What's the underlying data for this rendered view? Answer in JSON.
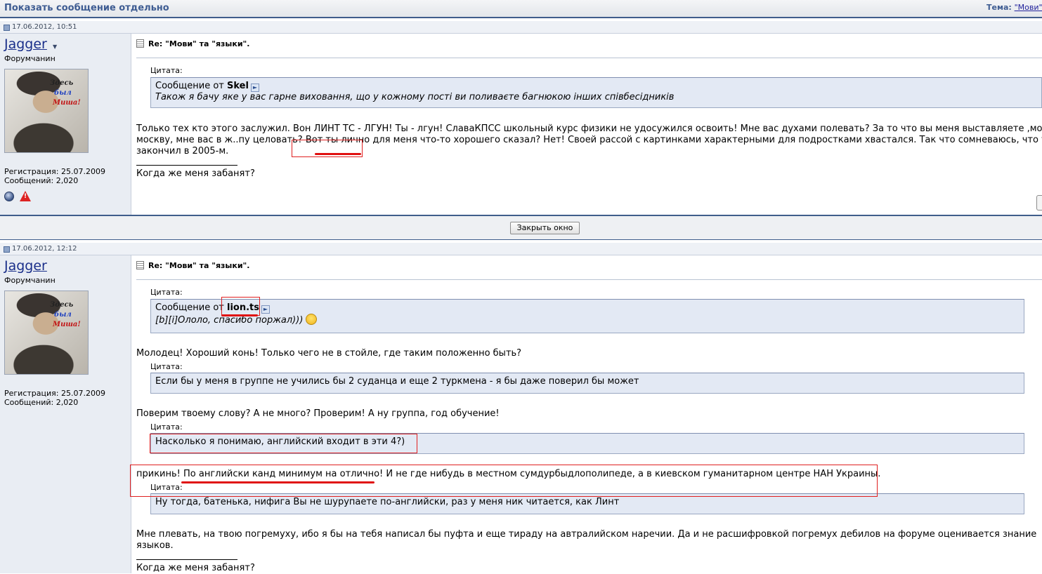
{
  "header": {
    "title": "Показать сообщение отдельно",
    "topic_label": "Тема:",
    "topic_link": "\"Мови\""
  },
  "post1": {
    "date": "17.06.2012, 10:51",
    "user": {
      "name": "Jagger",
      "title": "Форумчанин",
      "reg": "Регистрация: 25.07.2009",
      "posts": "Сообщений: 2,020"
    },
    "avatar_text": [
      "Здесь",
      "был",
      "Миша!"
    ],
    "post_title": "Re: \"Мови\" та \"языки\".",
    "quote_label": "Цитата:",
    "quote_from": "Сообщение от",
    "quote_author": "Skel",
    "quote_text": "Також я бачу яке у вас гарне виховання, що у кожному пості ви поливаєте багнюкою інших співбесідників",
    "text_line1": "Только тех кто этого заслужил. Вон ЛИНТ ТС - ЛГУН! Ты - лгун! СлаваКПСС школьный курс физики не удосужился освоить! Мне вас духами полевать? За то что вы меня выставляете ,мол",
    "text_line2": "москву, мне вас в ж..пу целовать? Вот ты лично для меня что-то хорошего сказал? Нет! Своей рассой с картинками характерными для подростками хвастался. Так что сомневаюсь, что ты",
    "text_line3": "закончил в 2005-м.",
    "signature": "Когда же меня забанят?"
  },
  "close_button": "Закрыть окно",
  "post2": {
    "date": "17.06.2012, 12:12",
    "user": {
      "name": "Jagger",
      "title": "Форумчанин",
      "reg": "Регистрация: 25.07.2009",
      "posts": "Сообщений: 2,020"
    },
    "avatar_text": [
      "Здесь",
      "был",
      "Миша!"
    ],
    "post_title": "Re: \"Мови\" та \"языки\".",
    "quote_label": "Цитата:",
    "quote1_from": "Сообщение от",
    "quote1_author": "lion.ts",
    "quote1_text": "[b][i]Ололо, спасибо поржал)))",
    "para1": "Молодец! Хороший конь! Только чего не в стойле, где таким положенно быть?",
    "quote2_text": "Если бы у меня в группе не учились бы 2 суданца и еще 2 туркмена - я бы даже поверил бы может",
    "para2": "Поверим твоему слову? А не много? Проверим! А ну группа, год обучение!",
    "quote3_text": "Насколько я понимаю, английский входит в эти 4?)",
    "para3": "прикинь! По английски канд минимум на отлично! И не где нибудь в местном сумдурбыдлополипеде, а в киевском гуманитарном центре НАН Украины.",
    "quote4_text": "Ну тогда, батенька, нифига Вы не шурупаете по-английски, раз у меня ник читается, как Линт",
    "para4_line1": "Мне плевать, на твою погремуху, ибо я бы на тебя написал бы пуфта и еще тираду на автралийском наречии. Да и не расшифровкой погремух дебилов на форуме оценивается знание",
    "para4_line2": "языков.",
    "signature": "Когда же меня забанят?"
  },
  "colors": {
    "accent": "#3f5d8b",
    "quote_bg": "#e3e9f4",
    "sidebar_bg": "#e9edf3",
    "annotation": "#e02020"
  }
}
